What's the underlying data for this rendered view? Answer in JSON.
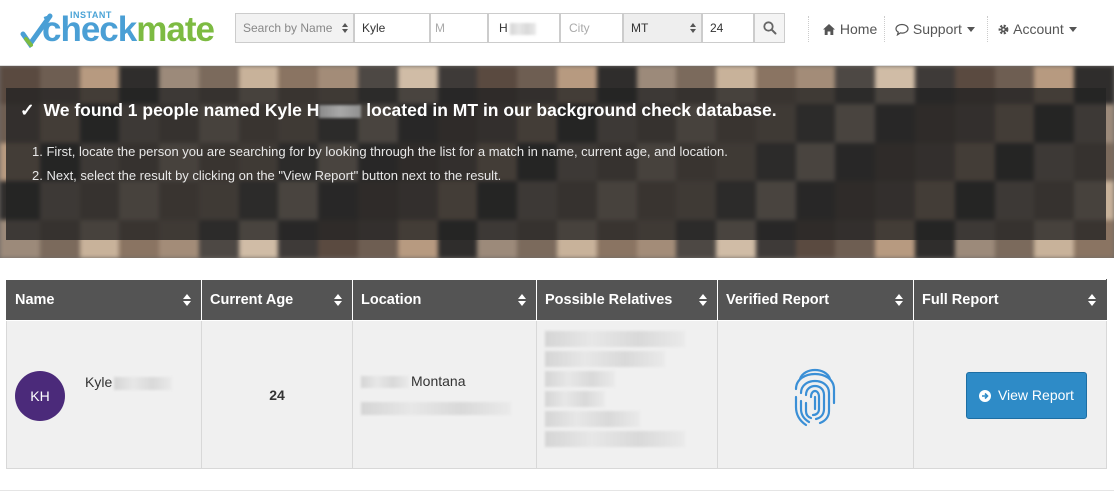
{
  "brand": {
    "instant": "INSTANT",
    "name_part1": "check",
    "name_part2": "mate"
  },
  "search": {
    "mode": "Search by Name",
    "first_name": "Kyle",
    "middle_initial_placeholder": "M",
    "last_name": "H",
    "city_placeholder": "City",
    "state": "MT",
    "age": "24"
  },
  "nav": {
    "home": "Home",
    "support": "Support",
    "account": "Account"
  },
  "hero": {
    "check": "✓",
    "title_part1": "We found 1 people named Kyle H",
    "title_part2": "located in MT in our background check database.",
    "steps": [
      "1.  First, locate the person you are searching for by looking through the list for a match in name, current age, and location.",
      "2.  Next, select the result by clicking on the \"View Report\" button next to the result."
    ]
  },
  "table": {
    "columns": [
      "Name",
      "Current Age",
      "Location",
      "Possible Relatives",
      "Verified Report",
      "Full Report"
    ],
    "rows": [
      {
        "initials": "KH",
        "first_name": "Kyle",
        "age": "24",
        "state": "Montana",
        "button": "View Report"
      }
    ]
  },
  "colors": {
    "accent": "#2e8bc7",
    "avatar": "#4b2a7a",
    "header_bg": "#545454",
    "fingerprint": "#3a8fd6"
  }
}
